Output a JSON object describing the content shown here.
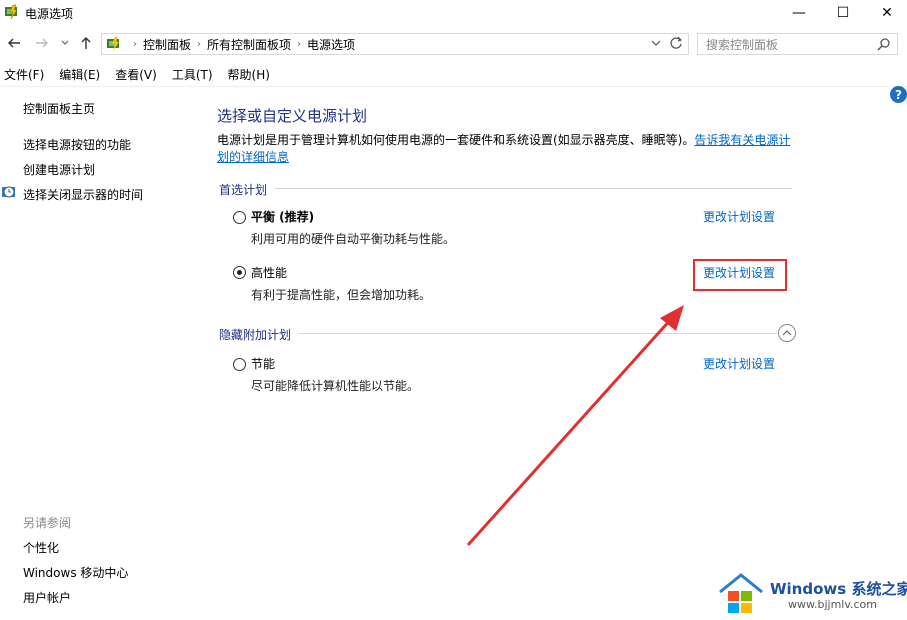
{
  "window": {
    "title": "电源选项",
    "minimize_glyph": "—",
    "maximize_glyph": "☐",
    "close_glyph": "✕"
  },
  "address": {
    "crumbs": [
      "控制面板",
      "所有控制面板项",
      "电源选项"
    ],
    "search_placeholder": "搜索控制面板"
  },
  "menu": [
    "文件(F)",
    "编辑(E)",
    "查看(V)",
    "工具(T)",
    "帮助(H)"
  ],
  "sidebar": {
    "home": "控制面板主页",
    "links": [
      "选择电源按钮的功能",
      "创建电源计划",
      "选择关闭显示器的时间"
    ],
    "see_also_title": "另请参阅",
    "see_also": [
      "个性化",
      "Windows 移动中心",
      "用户帐户"
    ]
  },
  "main": {
    "heading": "选择或自定义电源计划",
    "description": "电源计划是用于管理计算机如何使用电源的一套硬件和系统设置(如显示器亮度、睡眠等)。",
    "description_link": "告诉我有关电源计划的详细信息",
    "preferred_group": "首选计划",
    "hidden_group": "隐藏附加计划",
    "plans": [
      {
        "name": "平衡 (推荐)",
        "description": "利用可用的硬件自动平衡功耗与性能。",
        "link": "更改计划设置",
        "selected": false
      },
      {
        "name": "高性能",
        "description": "有利于提高性能，但会增加功耗。",
        "link": "更改计划设置",
        "selected": true
      },
      {
        "name": "节能",
        "description": "尽可能降低计算机性能以节能。",
        "link": "更改计划设置",
        "selected": false
      }
    ]
  },
  "help_glyph": "?",
  "watermark": {
    "brand": "Windows",
    "cn": "系统之家",
    "url": "www.bjjmlv.com"
  },
  "colors": {
    "heading": "#1e3287",
    "link": "#0066cc",
    "annotation": "#e03030"
  }
}
